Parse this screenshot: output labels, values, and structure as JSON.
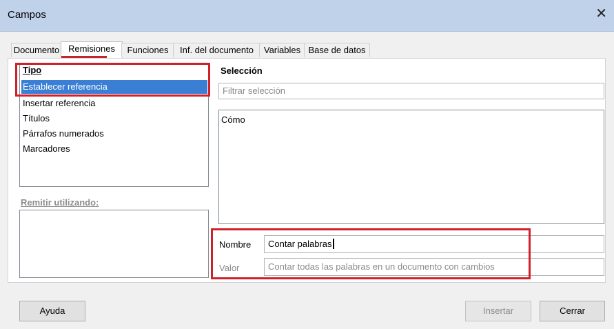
{
  "window": {
    "title": "Campos"
  },
  "tabs": [
    {
      "label": "Documento"
    },
    {
      "label": "Remisiones"
    },
    {
      "label": "Funciones"
    },
    {
      "label": "Inf. del documento"
    },
    {
      "label": "Variables"
    },
    {
      "label": "Base de datos"
    }
  ],
  "type_list": {
    "header": "Tipo",
    "items": [
      {
        "label": "Establecer referencia"
      },
      {
        "label": "Insertar referencia"
      },
      {
        "label": "Títulos"
      },
      {
        "label": "Párrafos numerados"
      },
      {
        "label": "Marcadores"
      }
    ]
  },
  "remit": {
    "label": "Remitir utilizando:"
  },
  "selection": {
    "title": "Selección",
    "filter_placeholder": "Filtrar selección",
    "items": [
      {
        "label": "Cómo"
      }
    ]
  },
  "name_field": {
    "label": "Nombre",
    "value": "Contar palabras"
  },
  "value_field": {
    "label": "Valor",
    "placeholder": "Contar todas las palabras en un documento con cambios"
  },
  "buttons": {
    "help": "Ayuda",
    "insert": "Insertar",
    "close": "Cerrar"
  },
  "colors": {
    "highlight": "#3a7fd4",
    "annotation_red": "#d0202a",
    "titlebar": "#bfd2e9"
  },
  "icons": {
    "close": "close-icon"
  }
}
